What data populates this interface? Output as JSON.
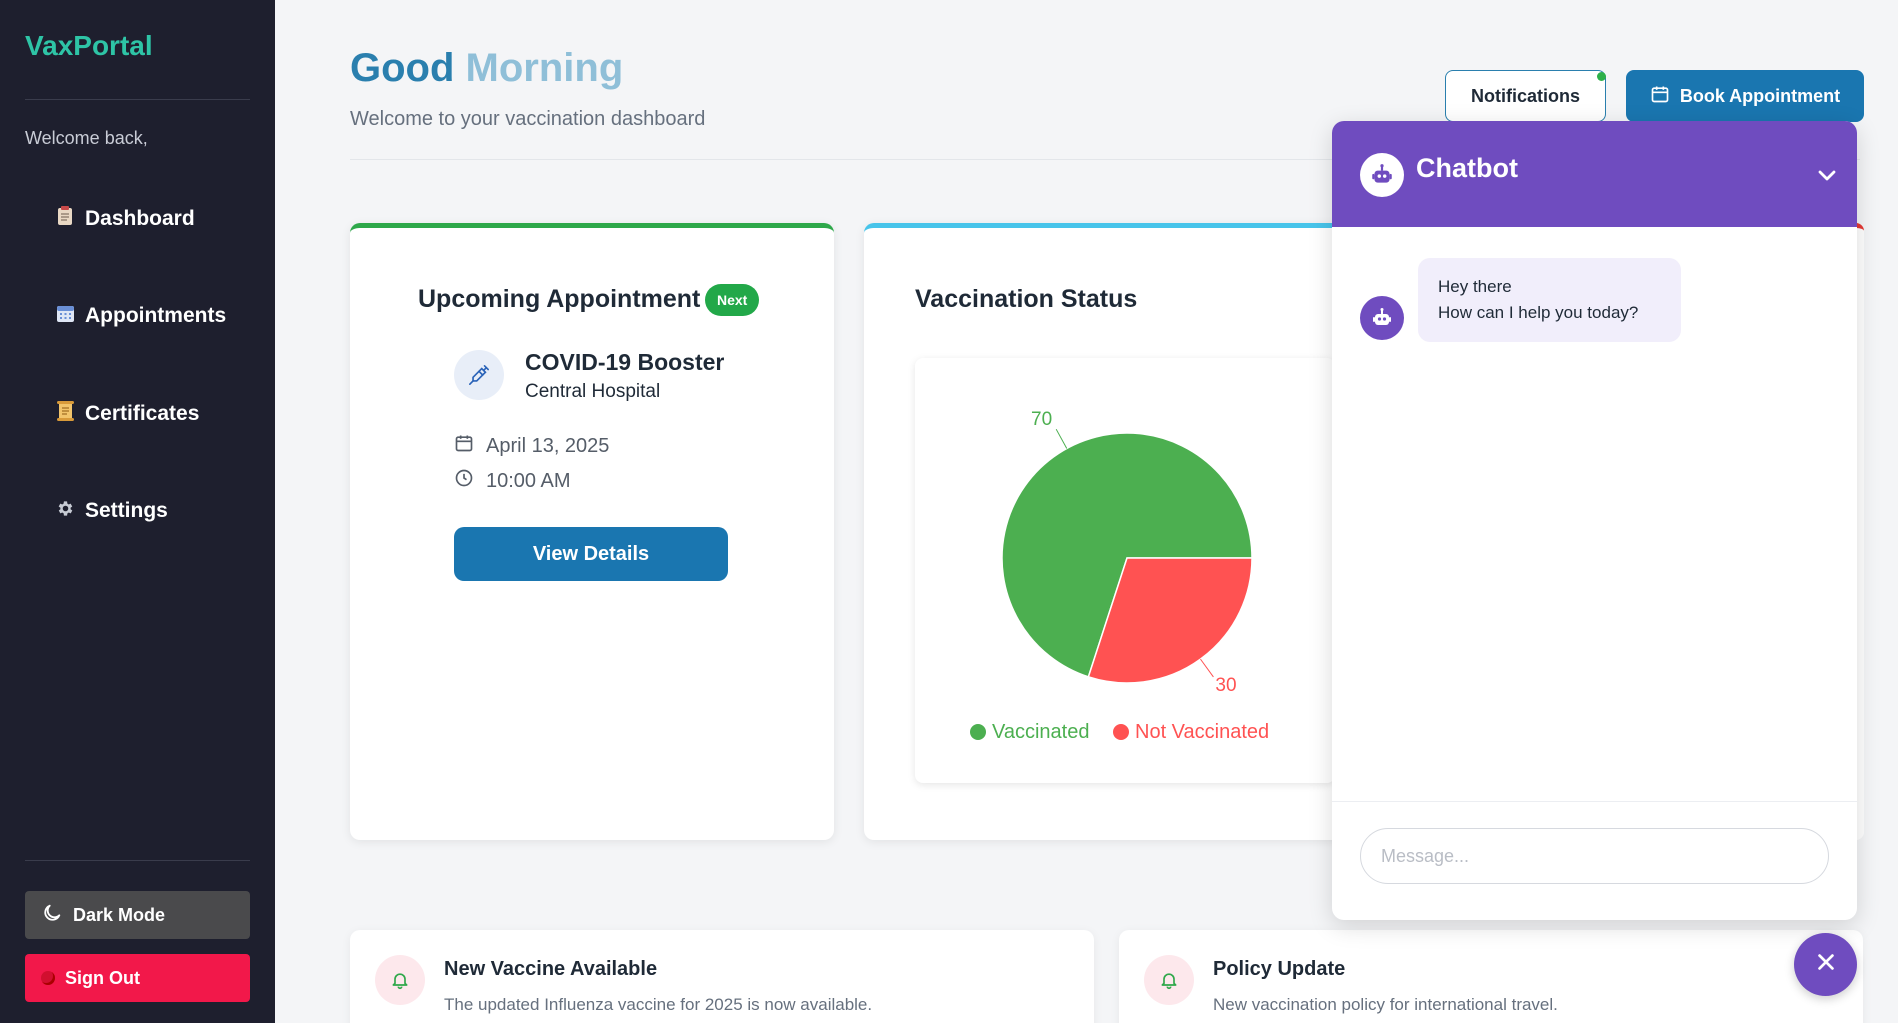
{
  "sidebar": {
    "brand": "VaxPortal",
    "welcome": "Welcome back,",
    "items": [
      {
        "label": "Dashboard",
        "icon": "clipboard-icon"
      },
      {
        "label": "Appointments",
        "icon": "calendar-icon"
      },
      {
        "label": "Certificates",
        "icon": "scroll-icon"
      },
      {
        "label": "Settings",
        "icon": "gear-icon"
      }
    ],
    "dark_mode_label": "Dark Mode",
    "sign_out_label": "Sign Out"
  },
  "header": {
    "greeting_part1": "Good",
    "greeting_part2": "Morning",
    "subtitle": "Welcome to your vaccination dashboard",
    "notifications_label": "Notifications",
    "book_label": "Book Appointment"
  },
  "appointment": {
    "title": "Upcoming Appointment",
    "badge": "Next",
    "vaccine": "COVID-19 Booster",
    "location": "Central Hospital",
    "date": "April 13, 2025",
    "time": "10:00 AM",
    "button": "View Details"
  },
  "vaccination": {
    "title": "Vaccination Status"
  },
  "chart_data": {
    "type": "pie",
    "categories": [
      "Vaccinated",
      "Not Vaccinated"
    ],
    "values": [
      70,
      30
    ],
    "colors": [
      "#4caf50",
      "#ff5252"
    ],
    "legend": "bottom"
  },
  "notifications": [
    {
      "title": "New Vaccine Available",
      "text": "The updated Influenza vaccine for 2025 is now available."
    },
    {
      "title": "Policy Update",
      "text": "New vaccination policy for international travel."
    }
  ],
  "chat": {
    "title": "Chatbot",
    "message_line1": "Hey there",
    "message_line2": "How can I help you today?",
    "input_placeholder": "Message..."
  },
  "colors": {
    "sidebar_bg": "#1e1f2e",
    "brand": "#2ec4a6",
    "primary": "#1a76b0",
    "chat_accent": "#6f4cbf",
    "sign_out": "#f2184a"
  }
}
